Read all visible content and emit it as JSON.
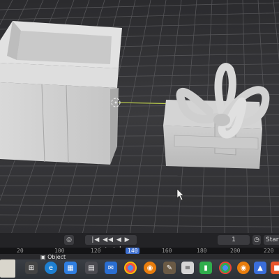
{
  "timeline": {
    "frame_current": "1",
    "start_label": "Start",
    "ruler_ticks": [
      "20",
      "100",
      "120",
      "140",
      "160",
      "180",
      "200",
      "220"
    ],
    "active_tick": "140"
  },
  "header": {
    "mode_label": "Object"
  },
  "colors": {
    "viewport_bg": "#38383a",
    "grid_line": "#505052",
    "object_fill": "#d2d2d2",
    "object_shadow": "#9c9c9c",
    "axis_line": "#b7c84b",
    "timeline_bg": "#232326",
    "taskbar_bg": "#33373c"
  },
  "taskbar": {
    "icons": [
      "files-icon",
      "edge-icon",
      "photos-icon",
      "store-icon",
      "mail-icon",
      "chrome-icon",
      "blender-icon",
      "gimp-icon",
      "notes-icon",
      "app-green-icon",
      "chrome-icon-2",
      "blender-icon-2",
      "paint-icon",
      "orange-app-icon"
    ]
  }
}
